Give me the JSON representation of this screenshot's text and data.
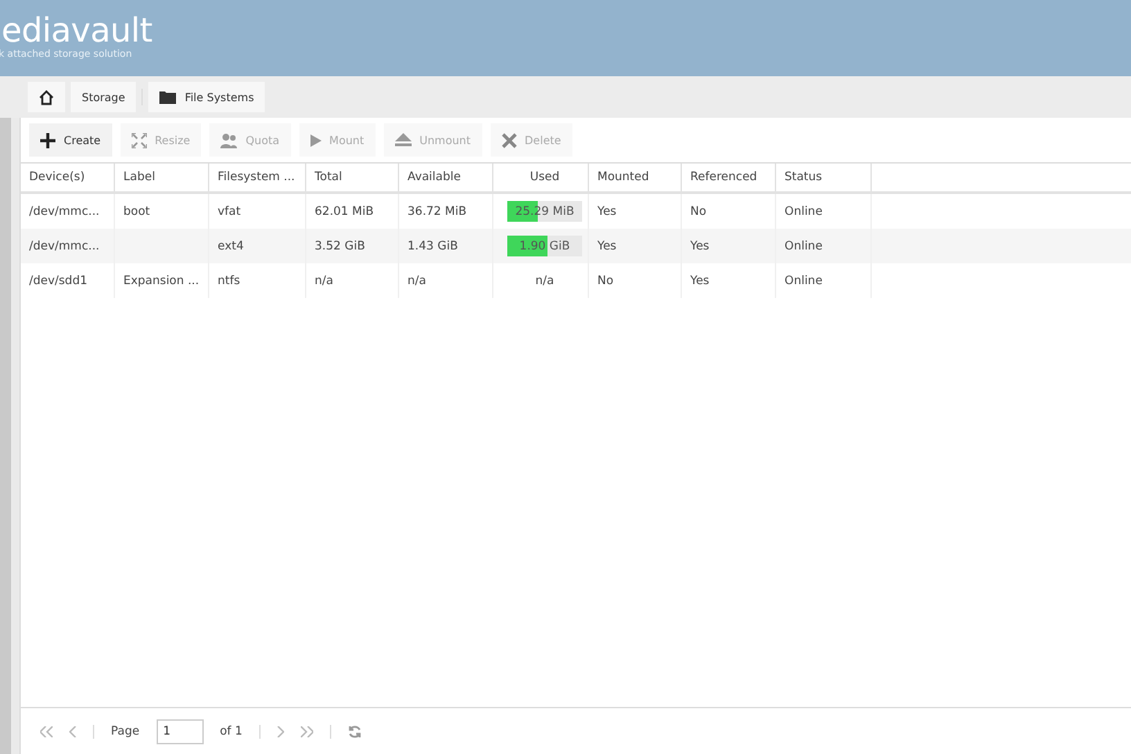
{
  "header": {
    "logo": "ediavault",
    "tagline": "k attached storage solution"
  },
  "breadcrumb": [
    {
      "label": "Storage",
      "kind": "text"
    },
    {
      "label": "File Systems",
      "kind": "folder"
    }
  ],
  "toolbar": [
    {
      "label": "Create",
      "kind": "plus",
      "disabled": false
    },
    {
      "label": "Resize",
      "kind": "resize",
      "disabled": true
    },
    {
      "label": "Quota",
      "kind": "users",
      "disabled": true
    },
    {
      "label": "Mount",
      "kind": "play",
      "disabled": true
    },
    {
      "label": "Unmount",
      "kind": "eject",
      "disabled": true
    },
    {
      "label": "Delete",
      "kind": "cross",
      "disabled": true
    }
  ],
  "table": {
    "columns": [
      "Device(s)",
      "Label",
      "Filesystem ...",
      "Total",
      "Available",
      "Used",
      "Mounted",
      "Referenced",
      "Status"
    ],
    "rows": [
      {
        "device": "/dev/mmc...",
        "label": "boot",
        "filesystem": "vfat",
        "total": "62.01 MiB",
        "available": "36.72 MiB",
        "used": {
          "kind": "bar",
          "text": "25.29 MiB",
          "level": 0.41
        },
        "mounted": "Yes",
        "referenced": "No",
        "status": "Online"
      },
      {
        "device": "/dev/mmc...",
        "label": "",
        "filesystem": "ext4",
        "total": "3.52 GiB",
        "available": "1.43 GiB",
        "used": {
          "kind": "bar",
          "text": "1.90 GiB",
          "level": 0.54
        },
        "mounted": "Yes",
        "referenced": "Yes",
        "status": "Online"
      },
      {
        "device": "/dev/sdd1",
        "label": "Expansion ...",
        "filesystem": "ntfs",
        "total": "n/a",
        "available": "n/a",
        "used": {
          "kind": "text",
          "text": "n/a"
        },
        "mounted": "No",
        "referenced": "Yes",
        "status": "Online"
      }
    ]
  },
  "pager": {
    "page_label": "Page",
    "page": "1",
    "of": "of 1"
  }
}
